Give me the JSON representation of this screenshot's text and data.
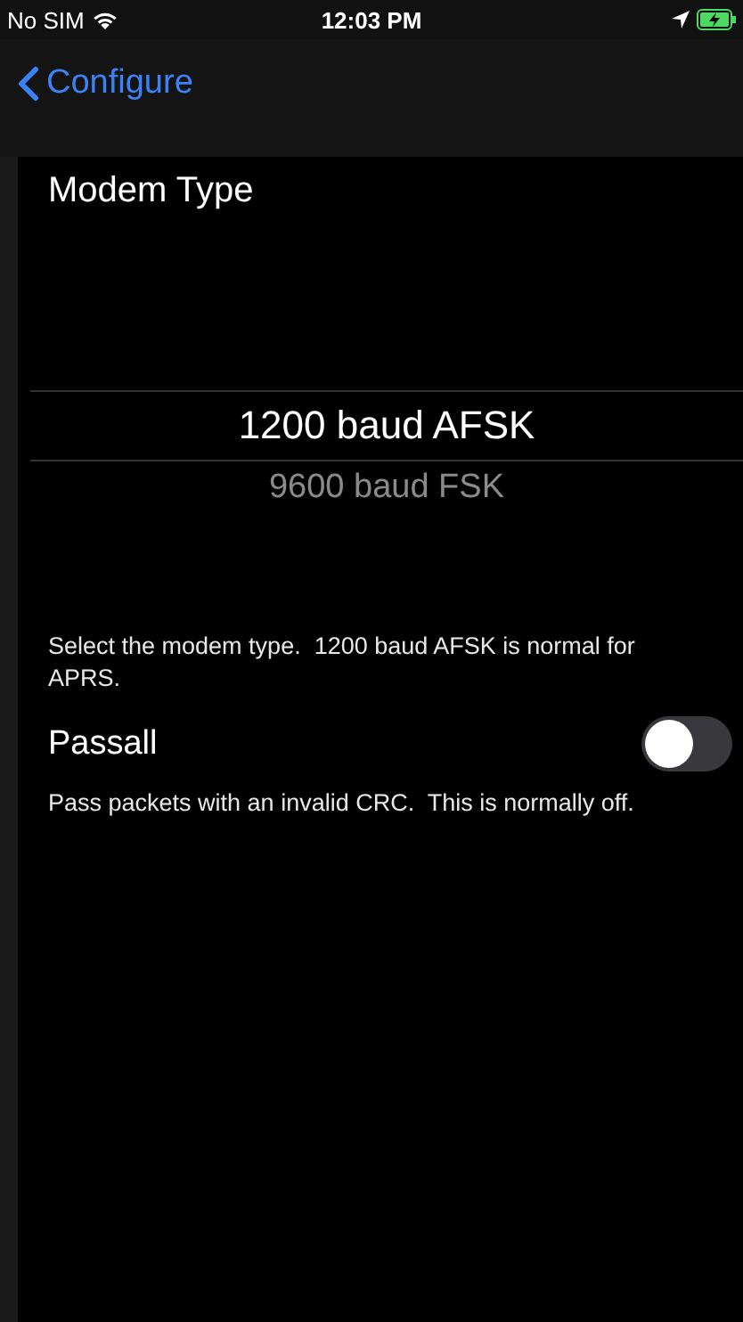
{
  "status_bar": {
    "carrier": "No SIM",
    "time": "12:03 PM"
  },
  "nav": {
    "back": "Configure"
  },
  "modem": {
    "title": "Modem Type",
    "options": [
      {
        "label": "1200 baud AFSK",
        "selected": true
      },
      {
        "label": "9600 baud FSK",
        "selected": false
      }
    ],
    "footer": "Select the modem type.  1200 baud AFSK is normal for APRS."
  },
  "passall": {
    "label": "Passall",
    "on": false,
    "footer": "Pass packets with an invalid CRC.  This is normally off."
  }
}
